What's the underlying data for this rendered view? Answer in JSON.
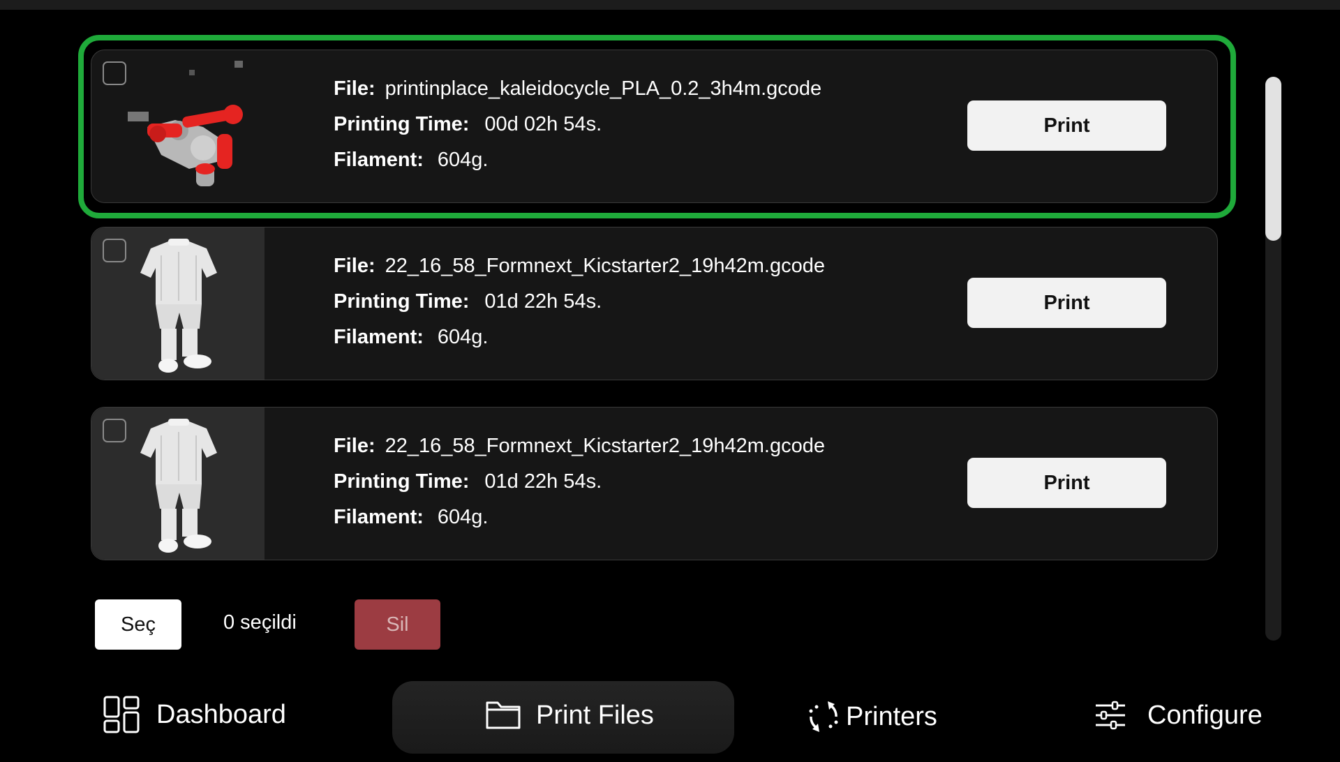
{
  "files": [
    {
      "file_label": "File:",
      "file_name": "printinplace_kaleidocycle_PLA_0.2_3h4m.gcode",
      "time_label": "Printing Time:",
      "time_value": "00d 02h 54s.",
      "filament_label": "Filament:",
      "filament_value": "604g.",
      "print_label": "Print",
      "selected": true,
      "thumbnail": "kaleidocycle-model"
    },
    {
      "file_label": "File:",
      "file_name": "22_16_58_Formnext_Kicstarter2_19h42m.gcode",
      "time_label": "Printing Time:",
      "time_value": "01d 22h 54s.",
      "filament_label": "Filament:",
      "filament_value": "604g.",
      "print_label": "Print",
      "selected": false,
      "thumbnail": "outfit-model"
    },
    {
      "file_label": "File:",
      "file_name": "22_16_58_Formnext_Kicstarter2_19h42m.gcode",
      "time_label": "Printing Time:",
      "time_value": "01d 22h 54s.",
      "filament_label": "Filament:",
      "filament_value": "604g.",
      "print_label": "Print",
      "selected": false,
      "thumbnail": "outfit-model"
    }
  ],
  "actions": {
    "select_label": "Seç",
    "selected_count": "0 seçildi",
    "delete_label": "Sil"
  },
  "nav": {
    "dashboard": "Dashboard",
    "print_files": "Print Files",
    "printers": "Printers",
    "configure": "Configure"
  },
  "colors": {
    "selected_outline": "#1faa3a",
    "delete_button": "#9c3c42",
    "card_background": "#161616"
  },
  "icons": {
    "dashboard": "grid-icon",
    "print_files": "folder-icon",
    "printers": "sync-icon",
    "configure": "sliders-icon"
  }
}
